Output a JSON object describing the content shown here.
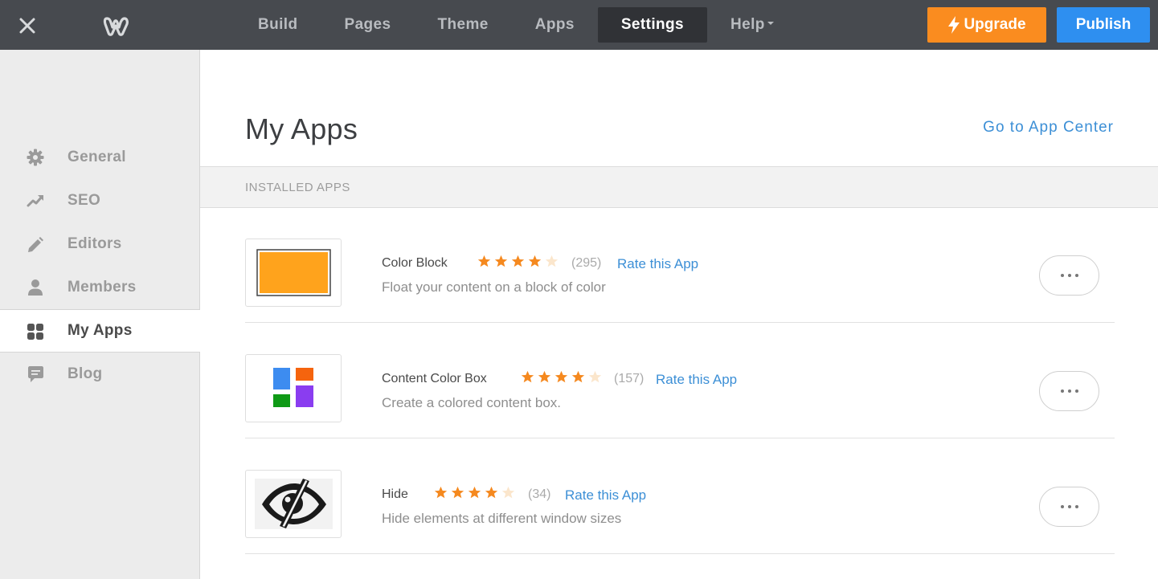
{
  "topbar": {
    "nav": [
      {
        "label": "Build"
      },
      {
        "label": "Pages"
      },
      {
        "label": "Theme"
      },
      {
        "label": "Apps"
      },
      {
        "label": "Settings"
      },
      {
        "label": "Help"
      }
    ],
    "active_nav": "Settings",
    "upgrade_label": "Upgrade",
    "publish_label": "Publish",
    "colors": {
      "bar": "#474a4f",
      "upgrade": "#fa8c1f",
      "publish": "#2e8ff0"
    }
  },
  "sidebar": {
    "items": [
      {
        "label": "General",
        "icon": "gear-icon"
      },
      {
        "label": "SEO",
        "icon": "trend-icon"
      },
      {
        "label": "Editors",
        "icon": "pencil-icon"
      },
      {
        "label": "Members",
        "icon": "person-icon"
      },
      {
        "label": "My Apps",
        "icon": "apps-grid-icon"
      },
      {
        "label": "Blog",
        "icon": "comment-icon"
      }
    ],
    "active": "My Apps"
  },
  "main": {
    "title": "My Apps",
    "app_center_link": "Go to App Center",
    "section_label": "INSTALLED APPS",
    "apps": [
      {
        "name": "Color Block",
        "rating": 4,
        "count": "(295)",
        "rate_label": "Rate this App",
        "description": "Float your content on a block of color"
      },
      {
        "name": "Content Color Box",
        "rating": 4,
        "count": "(157)",
        "rate_label": "Rate this App",
        "description": "Create a colored content box."
      },
      {
        "name": "Hide",
        "rating": 4,
        "count": "(34)",
        "rate_label": "Rate this App",
        "description": "Hide elements at different window sizes"
      }
    ]
  }
}
